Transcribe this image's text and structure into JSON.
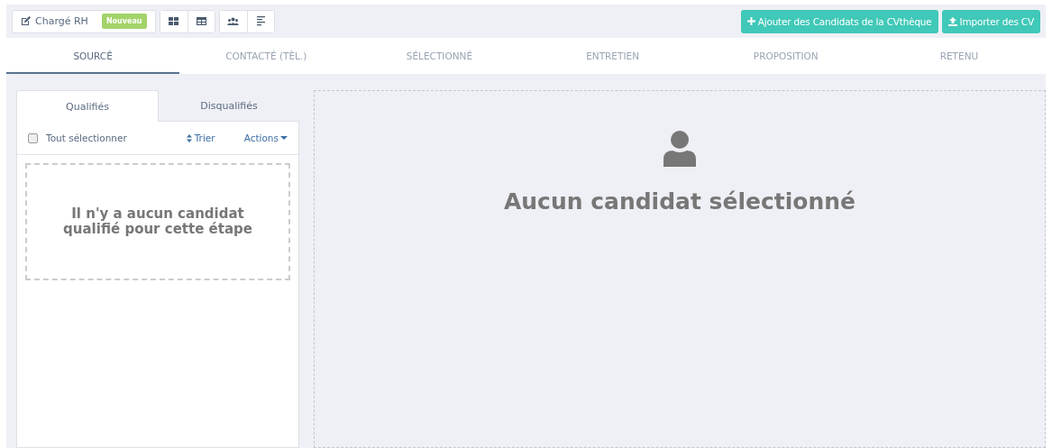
{
  "toolbar": {
    "job": {
      "label": "Chargé RH",
      "badge": "Nouveau"
    },
    "view_buttons": [
      {
        "kind": "grid"
      },
      {
        "kind": "table"
      },
      {
        "kind": "people"
      },
      {
        "kind": "list"
      }
    ],
    "actions": [
      {
        "kind": "add",
        "label": "Ajouter des Candidats de la CVthèque"
      },
      {
        "kind": "upload",
        "label": "Importer des CV"
      }
    ]
  },
  "stages": [
    {
      "label": "SOURCÉ",
      "selected": true
    },
    {
      "label": "CONTACTÉ (TÈL.)",
      "selected": false
    },
    {
      "label": "SÉLECTIONNÉ",
      "selected": false
    },
    {
      "label": "ENTRETIEN",
      "selected": false
    },
    {
      "label": "PROPOSITION",
      "selected": false
    },
    {
      "label": "RETENU",
      "selected": false
    }
  ],
  "list_panel": {
    "tabs": [
      {
        "label": "Qualifiés",
        "selected": true
      },
      {
        "label": "Disqualifiés",
        "selected": false
      }
    ],
    "select_all": {
      "label": "Tout sélectionner",
      "checked": false
    },
    "sort": "Trier",
    "actions": "Actions",
    "empty_message": "Il n'y a aucun candidat qualifié pour cette étape"
  },
  "detail": {
    "empty_message": "Aucun candidat sélectionné"
  }
}
